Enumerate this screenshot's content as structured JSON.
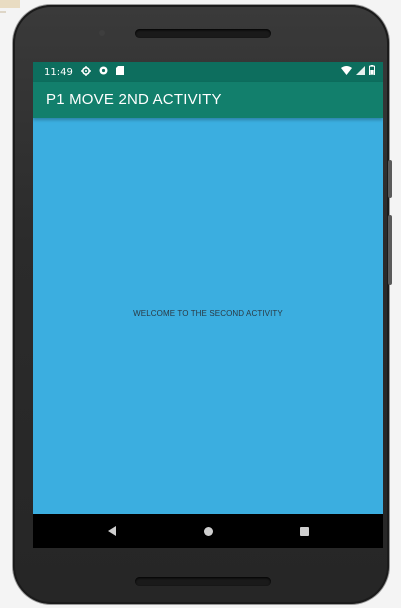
{
  "status_bar": {
    "time": "11:49",
    "icons": [
      "settings-icon",
      "record-icon",
      "sd-card-icon"
    ],
    "right_icons": [
      "wifi-icon",
      "signal-icon",
      "battery-icon"
    ]
  },
  "app_bar": {
    "title": "P1 MOVE 2ND ACTIVITY"
  },
  "content": {
    "message": "WELCOME TO THE SECOND ACTIVITY"
  },
  "nav_bar": {
    "buttons": [
      "back-icon",
      "home-icon",
      "recents-icon"
    ]
  },
  "colors": {
    "status_bar": "#0d6e5e",
    "app_bar": "#127f6c",
    "background": "#3baee0",
    "nav_bar": "#000000"
  }
}
